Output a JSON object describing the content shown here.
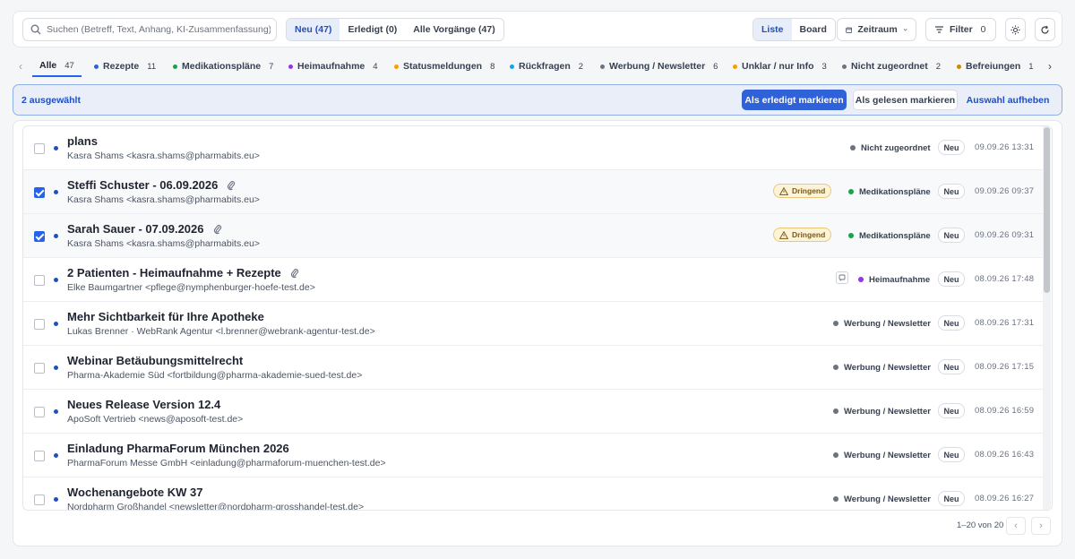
{
  "search": {
    "placeholder": "Suchen (Betreff, Text, Anhang, KI-Zusammenfassung) ..."
  },
  "status_tabs": [
    {
      "label": "Neu (47)",
      "active": true
    },
    {
      "label": "Erledigt (0)",
      "active": false
    },
    {
      "label": "Alle Vorgänge (47)",
      "active": false
    }
  ],
  "view_toggle": [
    {
      "label": "Liste",
      "active": true
    },
    {
      "label": "Board",
      "active": false
    }
  ],
  "toolbar": {
    "zeitraum_label": "Zeitraum",
    "filter_label": "Filter",
    "filter_count": "0"
  },
  "colors": {
    "accent": "#2563eb",
    "rezepte": "#2f62d8",
    "medikationsplaene": "#16a34a",
    "heimaufnahme": "#9333ea",
    "statusmeldungen": "#f59e0b",
    "rueckfragen": "#0ea5e9",
    "werbung": "#6b7280",
    "unklar": "#f59e0b",
    "nicht_zugeordnet": "#6b7280",
    "befreiungen": "#ca8a04"
  },
  "categories": [
    {
      "label": "Alle",
      "count": "47",
      "active": true
    },
    {
      "label": "Rezepte",
      "count": "11"
    },
    {
      "label": "Medikationspläne",
      "count": "7"
    },
    {
      "label": "Heimaufnahme",
      "count": "4"
    },
    {
      "label": "Statusmeldungen",
      "count": "8"
    },
    {
      "label": "Rückfragen",
      "count": "2"
    },
    {
      "label": "Werbung / Newsletter",
      "count": "6"
    },
    {
      "label": "Unklar / nur Info",
      "count": "3"
    },
    {
      "label": "Nicht zugeordnet",
      "count": "2"
    },
    {
      "label": "Befreiungen",
      "count": "1"
    }
  ],
  "selection": {
    "count_label": "2 ausgewählt",
    "mark_done_label": "Als erledigt markieren",
    "mark_read_label": "Als gelesen markieren",
    "clear_label": "Auswahl aufheben"
  },
  "messages": [
    {
      "subject": "plans",
      "sender": "Kasra Shams <kasra.shams@pharmabits.eu>",
      "category": "Nicht zugeordnet",
      "status": "Neu",
      "date": "09.09.26 13:31",
      "checked": false,
      "attachment": false,
      "urgent": false
    },
    {
      "subject": "Steffi Schuster - 06.09.2026",
      "sender": "Kasra Shams <kasra.shams@pharmabits.eu>",
      "category": "Medikationspläne",
      "status": "Neu",
      "date": "09.09.26 09:37",
      "checked": true,
      "attachment": true,
      "urgent": true,
      "urgent_label": "Dringend"
    },
    {
      "subject": "Sarah Sauer - 07.09.2026",
      "sender": "Kasra Shams <kasra.shams@pharmabits.eu>",
      "category": "Medikationspläne",
      "status": "Neu",
      "date": "09.09.26 09:31",
      "checked": true,
      "attachment": true,
      "urgent": true,
      "urgent_label": "Dringend"
    },
    {
      "subject": "2 Patienten - Heimaufnahme + Rezepte",
      "sender": "Elke Baumgartner <pflege@nymphenburger-hoefe-test.de>",
      "category": "Heimaufnahme",
      "status": "Neu",
      "date": "08.09.26 17:48",
      "checked": false,
      "attachment": true,
      "urgent": false,
      "note": true
    },
    {
      "subject": "Mehr Sichtbarkeit für Ihre Apotheke",
      "sender": "Lukas Brenner · WebRank Agentur <l.brenner@webrank-agentur-test.de>",
      "category": "Werbung / Newsletter",
      "status": "Neu",
      "date": "08.09.26 17:31",
      "checked": false,
      "attachment": false,
      "urgent": false
    },
    {
      "subject": "Webinar Betäubungsmittelrecht",
      "sender": "Pharma-Akademie Süd <fortbildung@pharma-akademie-sued-test.de>",
      "category": "Werbung / Newsletter",
      "status": "Neu",
      "date": "08.09.26 17:15",
      "checked": false,
      "attachment": false,
      "urgent": false
    },
    {
      "subject": "Neues Release Version 12.4",
      "sender": "ApoSoft Vertrieb <news@aposoft-test.de>",
      "category": "Werbung / Newsletter",
      "status": "Neu",
      "date": "08.09.26 16:59",
      "checked": false,
      "attachment": false,
      "urgent": false
    },
    {
      "subject": "Einladung PharmaForum München 2026",
      "sender": "PharmaForum Messe GmbH <einladung@pharmaforum-muenchen-test.de>",
      "category": "Werbung / Newsletter",
      "status": "Neu",
      "date": "08.09.26 16:43",
      "checked": false,
      "attachment": false,
      "urgent": false
    },
    {
      "subject": "Wochenangebote KW 37",
      "sender": "Nordpharm Großhandel <newsletter@nordpharm-grosshandel-test.de>",
      "category": "Werbung / Newsletter",
      "status": "Neu",
      "date": "08.09.26 16:27",
      "checked": false,
      "attachment": false,
      "urgent": false
    }
  ],
  "pagination": {
    "label": "1–20 von 20"
  }
}
